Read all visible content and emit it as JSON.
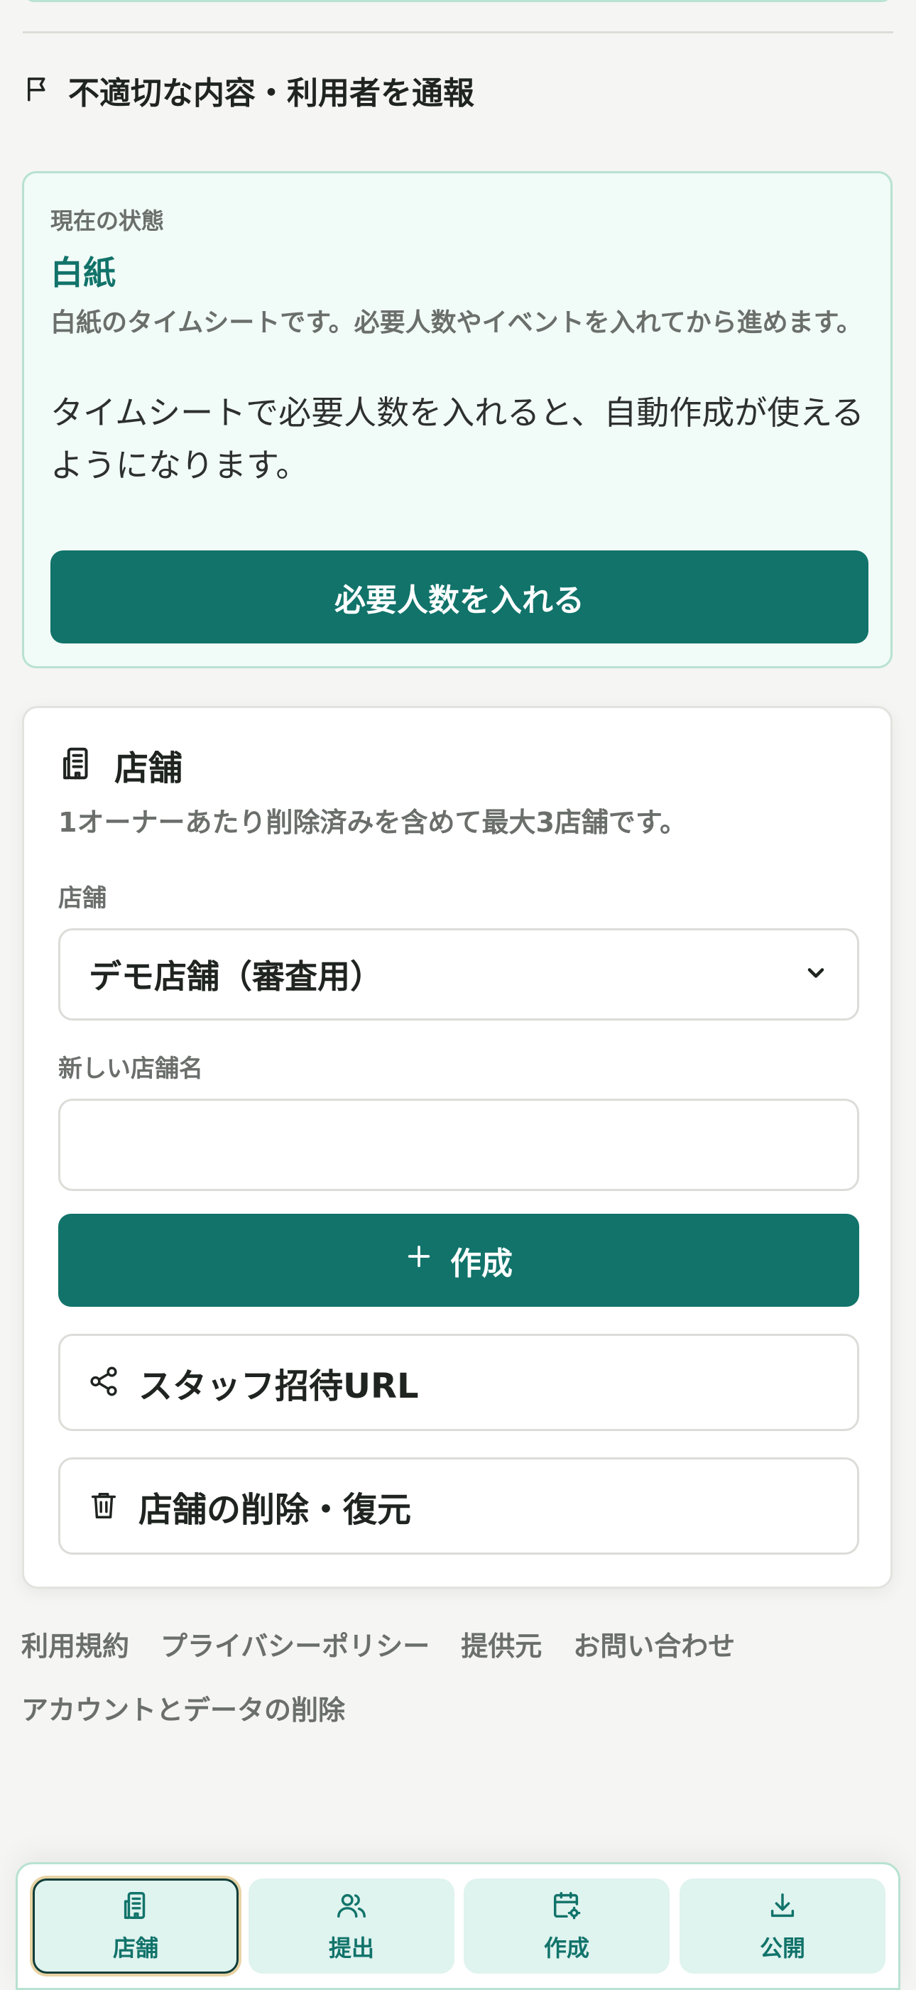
{
  "report": {
    "label": "不適切な内容・利用者を通報",
    "icon": "flag-icon"
  },
  "status": {
    "caption": "現在の状態",
    "value": "白紙",
    "description": "白紙のタイムシートです。必要人数やイベントを入れてから進めます。",
    "hint": "タイムシートで必要人数を入れると、自動作成が使えるようになります。",
    "button_label": "必要人数を入れる"
  },
  "store": {
    "title": "店舗",
    "icon": "building-icon",
    "note": "1オーナーあたり削除済みを含めて最大3店舗です。",
    "select_label": "店舗",
    "selected_store": "デモ店舗（審査用）",
    "new_name_label": "新しい店舗名",
    "new_name_value": "",
    "create_label": "作成",
    "invite_label": "スタッフ招待URL",
    "delete_label": "店舗の削除・復元"
  },
  "footer": {
    "links": [
      "利用規約",
      "プライバシーポリシー",
      "提供元",
      "お問い合わせ",
      "アカウントとデータの削除"
    ]
  },
  "tabs": [
    {
      "label": "店舗",
      "icon": "building-icon",
      "active": true
    },
    {
      "label": "提出",
      "icon": "users-icon",
      "active": false
    },
    {
      "label": "作成",
      "icon": "calendar-gear-icon",
      "active": false
    },
    {
      "label": "公開",
      "icon": "download-icon",
      "active": false
    }
  ],
  "colors": {
    "accent": "#11736a",
    "status_bg": "#f1fbf7",
    "status_border": "#b8e2d1",
    "tab_bg": "#dff3ef",
    "active_ring": "#e8d3a5"
  }
}
